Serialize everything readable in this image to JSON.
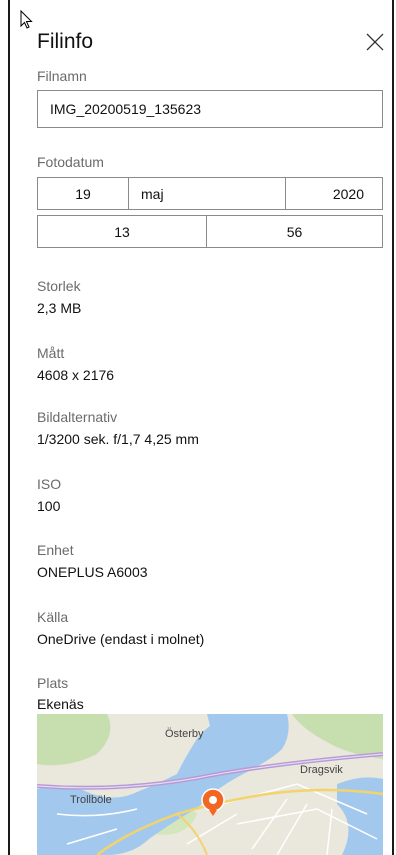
{
  "panel": {
    "title": "Filinfo"
  },
  "filename": {
    "label": "Filnamn",
    "value": "IMG_20200519_135623"
  },
  "photo_date": {
    "label": "Fotodatum",
    "day": "19",
    "month": "maj",
    "year": "2020",
    "hour": "13",
    "minute": "56"
  },
  "size": {
    "label": "Storlek",
    "value": "2,3 MB"
  },
  "dimensions": {
    "label": "Mått",
    "value": "4608 x 2176"
  },
  "image_options": {
    "label": "Bildalternativ",
    "value": "1/3200 sek. f/1,7 4,25 mm"
  },
  "iso": {
    "label": "ISO",
    "value": "100"
  },
  "device": {
    "label": "Enhet",
    "value": "ONEPLUS A6003"
  },
  "source": {
    "label": "Källa",
    "value": "OneDrive (endast i molnet)"
  },
  "location": {
    "label": "Plats",
    "value": "Ekenäs",
    "map_labels": [
      "Österby",
      "Dragsvik",
      "Trollböle"
    ]
  },
  "icons": {
    "close": "close-icon",
    "pin": "map-pin-icon",
    "cursor": "mouse-pointer-icon"
  },
  "colors": {
    "pin": "#f26722",
    "water": "#a3c8ee",
    "land": "#eae7dc",
    "forest": "#c7dfae",
    "highway": "#b69ad6"
  }
}
